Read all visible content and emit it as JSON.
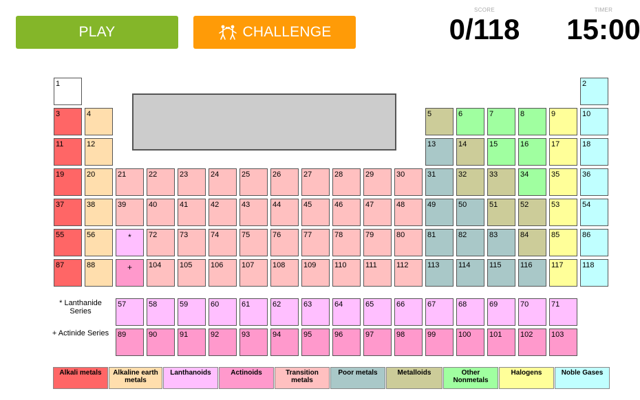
{
  "header": {
    "play_label": "PLAY",
    "challenge_label": "CHALLENGE",
    "score_label": "SCORE",
    "score_value": "0/118",
    "timer_label": "TIMER",
    "timer_value": "15:00"
  },
  "colors": {
    "empty": "#ffffff",
    "alkali": "#ff6666",
    "alkaline": "#ffdead",
    "lanthanoid": "#ffbfff",
    "actinoid": "#ff99cc",
    "transition": "#ffc0c0",
    "poor": "#a9c8c8",
    "metalloid": "#cccc99",
    "nonmetal": "#a0ffa0",
    "halogen": "#ffff99",
    "noble": "#c0ffff"
  },
  "markers": {
    "lanthanide": "*",
    "actinide": "+"
  },
  "series_labels": {
    "lanthanide": "* Lanthanide Series",
    "actinide": "+ Actinide Series"
  },
  "legend": [
    {
      "label": "Alkali metals",
      "cat": "alkali"
    },
    {
      "label": "Alkaline earth metals",
      "cat": "alkaline"
    },
    {
      "label": "Lanthanoids",
      "cat": "lanthanoid"
    },
    {
      "label": "Actinoids",
      "cat": "actinoid"
    },
    {
      "label": "Transition metals",
      "cat": "transition"
    },
    {
      "label": "Poor metals",
      "cat": "poor"
    },
    {
      "label": "Metalloids",
      "cat": "metalloid"
    },
    {
      "label": "Other Nonmetals",
      "cat": "nonmetal"
    },
    {
      "label": "Halogens",
      "cat": "halogen"
    },
    {
      "label": "Noble Gases",
      "cat": "noble"
    }
  ],
  "elements": [
    {
      "n": "1",
      "row": 1,
      "col": 1,
      "cat": "empty"
    },
    {
      "n": "2",
      "row": 1,
      "col": 18,
      "cat": "noble"
    },
    {
      "n": "3",
      "row": 2,
      "col": 1,
      "cat": "alkali"
    },
    {
      "n": "4",
      "row": 2,
      "col": 2,
      "cat": "alkaline"
    },
    {
      "n": "5",
      "row": 2,
      "col": 13,
      "cat": "metalloid"
    },
    {
      "n": "6",
      "row": 2,
      "col": 14,
      "cat": "nonmetal"
    },
    {
      "n": "7",
      "row": 2,
      "col": 15,
      "cat": "nonmetal"
    },
    {
      "n": "8",
      "row": 2,
      "col": 16,
      "cat": "nonmetal"
    },
    {
      "n": "9",
      "row": 2,
      "col": 17,
      "cat": "halogen"
    },
    {
      "n": "10",
      "row": 2,
      "col": 18,
      "cat": "noble"
    },
    {
      "n": "11",
      "row": 3,
      "col": 1,
      "cat": "alkali"
    },
    {
      "n": "12",
      "row": 3,
      "col": 2,
      "cat": "alkaline"
    },
    {
      "n": "13",
      "row": 3,
      "col": 13,
      "cat": "poor"
    },
    {
      "n": "14",
      "row": 3,
      "col": 14,
      "cat": "metalloid"
    },
    {
      "n": "15",
      "row": 3,
      "col": 15,
      "cat": "nonmetal"
    },
    {
      "n": "16",
      "row": 3,
      "col": 16,
      "cat": "nonmetal"
    },
    {
      "n": "17",
      "row": 3,
      "col": 17,
      "cat": "halogen"
    },
    {
      "n": "18",
      "row": 3,
      "col": 18,
      "cat": "noble"
    },
    {
      "n": "19",
      "row": 4,
      "col": 1,
      "cat": "alkali"
    },
    {
      "n": "20",
      "row": 4,
      "col": 2,
      "cat": "alkaline"
    },
    {
      "n": "21",
      "row": 4,
      "col": 3,
      "cat": "transition"
    },
    {
      "n": "22",
      "row": 4,
      "col": 4,
      "cat": "transition"
    },
    {
      "n": "23",
      "row": 4,
      "col": 5,
      "cat": "transition"
    },
    {
      "n": "24",
      "row": 4,
      "col": 6,
      "cat": "transition"
    },
    {
      "n": "25",
      "row": 4,
      "col": 7,
      "cat": "transition"
    },
    {
      "n": "26",
      "row": 4,
      "col": 8,
      "cat": "transition"
    },
    {
      "n": "27",
      "row": 4,
      "col": 9,
      "cat": "transition"
    },
    {
      "n": "28",
      "row": 4,
      "col": 10,
      "cat": "transition"
    },
    {
      "n": "29",
      "row": 4,
      "col": 11,
      "cat": "transition"
    },
    {
      "n": "30",
      "row": 4,
      "col": 12,
      "cat": "transition"
    },
    {
      "n": "31",
      "row": 4,
      "col": 13,
      "cat": "poor"
    },
    {
      "n": "32",
      "row": 4,
      "col": 14,
      "cat": "metalloid"
    },
    {
      "n": "33",
      "row": 4,
      "col": 15,
      "cat": "metalloid"
    },
    {
      "n": "34",
      "row": 4,
      "col": 16,
      "cat": "nonmetal"
    },
    {
      "n": "35",
      "row": 4,
      "col": 17,
      "cat": "halogen"
    },
    {
      "n": "36",
      "row": 4,
      "col": 18,
      "cat": "noble"
    },
    {
      "n": "37",
      "row": 5,
      "col": 1,
      "cat": "alkali"
    },
    {
      "n": "38",
      "row": 5,
      "col": 2,
      "cat": "alkaline"
    },
    {
      "n": "39",
      "row": 5,
      "col": 3,
      "cat": "transition"
    },
    {
      "n": "40",
      "row": 5,
      "col": 4,
      "cat": "transition"
    },
    {
      "n": "41",
      "row": 5,
      "col": 5,
      "cat": "transition"
    },
    {
      "n": "42",
      "row": 5,
      "col": 6,
      "cat": "transition"
    },
    {
      "n": "43",
      "row": 5,
      "col": 7,
      "cat": "transition"
    },
    {
      "n": "44",
      "row": 5,
      "col": 8,
      "cat": "transition"
    },
    {
      "n": "45",
      "row": 5,
      "col": 9,
      "cat": "transition"
    },
    {
      "n": "46",
      "row": 5,
      "col": 10,
      "cat": "transition"
    },
    {
      "n": "47",
      "row": 5,
      "col": 11,
      "cat": "transition"
    },
    {
      "n": "48",
      "row": 5,
      "col": 12,
      "cat": "transition"
    },
    {
      "n": "49",
      "row": 5,
      "col": 13,
      "cat": "poor"
    },
    {
      "n": "50",
      "row": 5,
      "col": 14,
      "cat": "poor"
    },
    {
      "n": "51",
      "row": 5,
      "col": 15,
      "cat": "metalloid"
    },
    {
      "n": "52",
      "row": 5,
      "col": 16,
      "cat": "metalloid"
    },
    {
      "n": "53",
      "row": 5,
      "col": 17,
      "cat": "halogen"
    },
    {
      "n": "54",
      "row": 5,
      "col": 18,
      "cat": "noble"
    },
    {
      "n": "55",
      "row": 6,
      "col": 1,
      "cat": "alkali"
    },
    {
      "n": "56",
      "row": 6,
      "col": 2,
      "cat": "alkaline"
    },
    {
      "n": "72",
      "row": 6,
      "col": 4,
      "cat": "transition"
    },
    {
      "n": "73",
      "row": 6,
      "col": 5,
      "cat": "transition"
    },
    {
      "n": "74",
      "row": 6,
      "col": 6,
      "cat": "transition"
    },
    {
      "n": "75",
      "row": 6,
      "col": 7,
      "cat": "transition"
    },
    {
      "n": "76",
      "row": 6,
      "col": 8,
      "cat": "transition"
    },
    {
      "n": "77",
      "row": 6,
      "col": 9,
      "cat": "transition"
    },
    {
      "n": "78",
      "row": 6,
      "col": 10,
      "cat": "transition"
    },
    {
      "n": "79",
      "row": 6,
      "col": 11,
      "cat": "transition"
    },
    {
      "n": "80",
      "row": 6,
      "col": 12,
      "cat": "transition"
    },
    {
      "n": "81",
      "row": 6,
      "col": 13,
      "cat": "poor"
    },
    {
      "n": "82",
      "row": 6,
      "col": 14,
      "cat": "poor"
    },
    {
      "n": "83",
      "row": 6,
      "col": 15,
      "cat": "poor"
    },
    {
      "n": "84",
      "row": 6,
      "col": 16,
      "cat": "metalloid"
    },
    {
      "n": "85",
      "row": 6,
      "col": 17,
      "cat": "halogen"
    },
    {
      "n": "86",
      "row": 6,
      "col": 18,
      "cat": "noble"
    },
    {
      "n": "87",
      "row": 7,
      "col": 1,
      "cat": "alkali"
    },
    {
      "n": "88",
      "row": 7,
      "col": 2,
      "cat": "alkaline"
    },
    {
      "n": "104",
      "row": 7,
      "col": 4,
      "cat": "transition"
    },
    {
      "n": "105",
      "row": 7,
      "col": 5,
      "cat": "transition"
    },
    {
      "n": "106",
      "row": 7,
      "col": 6,
      "cat": "transition"
    },
    {
      "n": "107",
      "row": 7,
      "col": 7,
      "cat": "transition"
    },
    {
      "n": "108",
      "row": 7,
      "col": 8,
      "cat": "transition"
    },
    {
      "n": "109",
      "row": 7,
      "col": 9,
      "cat": "transition"
    },
    {
      "n": "110",
      "row": 7,
      "col": 10,
      "cat": "transition"
    },
    {
      "n": "111",
      "row": 7,
      "col": 11,
      "cat": "transition"
    },
    {
      "n": "112",
      "row": 7,
      "col": 12,
      "cat": "transition"
    },
    {
      "n": "113",
      "row": 7,
      "col": 13,
      "cat": "poor"
    },
    {
      "n": "114",
      "row": 7,
      "col": 14,
      "cat": "poor"
    },
    {
      "n": "115",
      "row": 7,
      "col": 15,
      "cat": "poor"
    },
    {
      "n": "116",
      "row": 7,
      "col": 16,
      "cat": "poor"
    },
    {
      "n": "117",
      "row": 7,
      "col": 17,
      "cat": "halogen"
    },
    {
      "n": "118",
      "row": 7,
      "col": 18,
      "cat": "noble"
    },
    {
      "n": "57",
      "row": 8,
      "col": 3,
      "cat": "lanthanoid"
    },
    {
      "n": "58",
      "row": 8,
      "col": 4,
      "cat": "lanthanoid"
    },
    {
      "n": "59",
      "row": 8,
      "col": 5,
      "cat": "lanthanoid"
    },
    {
      "n": "60",
      "row": 8,
      "col": 6,
      "cat": "lanthanoid"
    },
    {
      "n": "61",
      "row": 8,
      "col": 7,
      "cat": "lanthanoid"
    },
    {
      "n": "62",
      "row": 8,
      "col": 8,
      "cat": "lanthanoid"
    },
    {
      "n": "63",
      "row": 8,
      "col": 9,
      "cat": "lanthanoid"
    },
    {
      "n": "64",
      "row": 8,
      "col": 10,
      "cat": "lanthanoid"
    },
    {
      "n": "65",
      "row": 8,
      "col": 11,
      "cat": "lanthanoid"
    },
    {
      "n": "66",
      "row": 8,
      "col": 12,
      "cat": "lanthanoid"
    },
    {
      "n": "67",
      "row": 8,
      "col": 13,
      "cat": "lanthanoid"
    },
    {
      "n": "68",
      "row": 8,
      "col": 14,
      "cat": "lanthanoid"
    },
    {
      "n": "69",
      "row": 8,
      "col": 15,
      "cat": "lanthanoid"
    },
    {
      "n": "70",
      "row": 8,
      "col": 16,
      "cat": "lanthanoid"
    },
    {
      "n": "71",
      "row": 8,
      "col": 17,
      "cat": "lanthanoid"
    },
    {
      "n": "89",
      "row": 9,
      "col": 3,
      "cat": "actinoid"
    },
    {
      "n": "90",
      "row": 9,
      "col": 4,
      "cat": "actinoid"
    },
    {
      "n": "91",
      "row": 9,
      "col": 5,
      "cat": "actinoid"
    },
    {
      "n": "92",
      "row": 9,
      "col": 6,
      "cat": "actinoid"
    },
    {
      "n": "93",
      "row": 9,
      "col": 7,
      "cat": "actinoid"
    },
    {
      "n": "94",
      "row": 9,
      "col": 8,
      "cat": "actinoid"
    },
    {
      "n": "95",
      "row": 9,
      "col": 9,
      "cat": "actinoid"
    },
    {
      "n": "96",
      "row": 9,
      "col": 10,
      "cat": "actinoid"
    },
    {
      "n": "97",
      "row": 9,
      "col": 11,
      "cat": "actinoid"
    },
    {
      "n": "98",
      "row": 9,
      "col": 12,
      "cat": "actinoid"
    },
    {
      "n": "99",
      "row": 9,
      "col": 13,
      "cat": "actinoid"
    },
    {
      "n": "100",
      "row": 9,
      "col": 14,
      "cat": "actinoid"
    },
    {
      "n": "101",
      "row": 9,
      "col": 15,
      "cat": "actinoid"
    },
    {
      "n": "102",
      "row": 9,
      "col": 16,
      "cat": "actinoid"
    },
    {
      "n": "103",
      "row": 9,
      "col": 17,
      "cat": "actinoid"
    }
  ]
}
